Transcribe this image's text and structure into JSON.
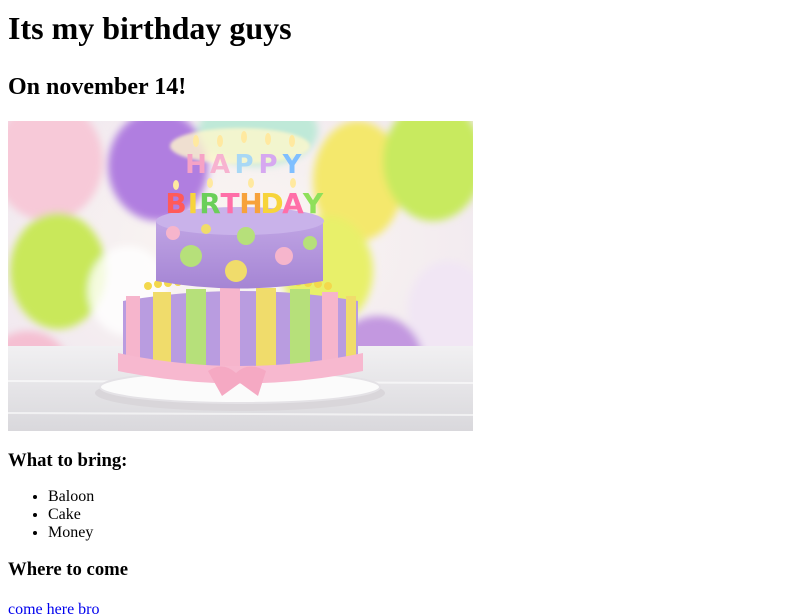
{
  "header": {
    "title": "Its my birthday guys",
    "subtitle": "On november 14!"
  },
  "image": {
    "depicts": "two-tier birthday cake with candles spelling HAPPY BIRTHDAY, balloons in background",
    "candle_text_top": "HAPPY",
    "candle_text_bottom": "BIRTHDAY",
    "colors": {
      "sky": "#f3ecf4",
      "balloon_purple": "#b48ad8",
      "balloon_green": "#c8e85a",
      "balloon_yellow": "#f2ea6a",
      "balloon_pink": "#f6c2d8",
      "cake_purple": "#b99ce0",
      "cake_pink": "#f7b8cf",
      "table": "#e9e8ea"
    }
  },
  "bring": {
    "heading": "What to bring:",
    "items": [
      "Baloon",
      "Cake",
      "Money"
    ]
  },
  "where": {
    "heading": "Where to come",
    "link_text": "come here bro"
  }
}
